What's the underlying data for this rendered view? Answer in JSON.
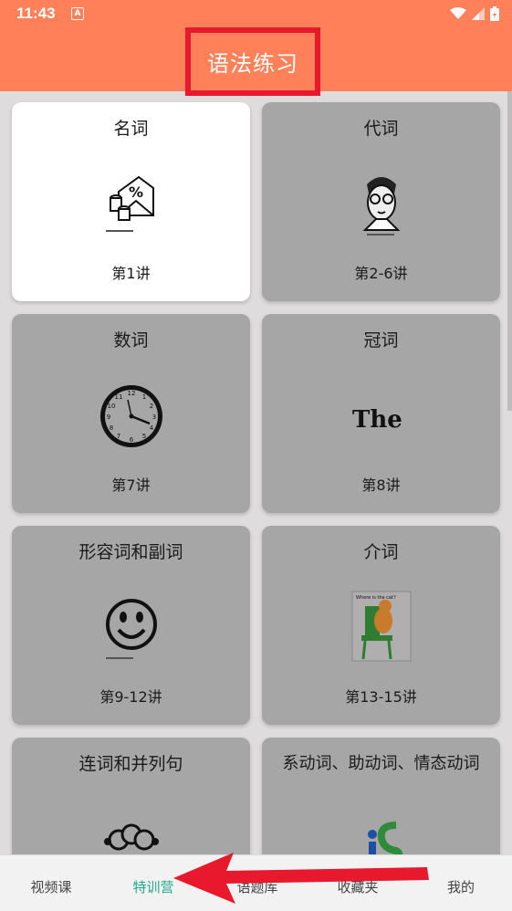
{
  "status_bar": {
    "time": "11:43",
    "notification_glyph": "A"
  },
  "app_bar": {
    "title": "语法练习"
  },
  "cards": [
    {
      "name": "名词",
      "lessons": "第1讲",
      "icon": "envelope-percent-coins-icon",
      "active": true
    },
    {
      "name": "代词",
      "lessons": "第2-6讲",
      "icon": "glasses-man-icon",
      "active": false
    },
    {
      "name": "数词",
      "lessons": "第7讲",
      "icon": "clock-icon",
      "active": false
    },
    {
      "name": "冠词",
      "lessons": "第8讲",
      "icon": "the-word-icon",
      "icon_text": "The",
      "active": false
    },
    {
      "name": "形容词和副词",
      "lessons": "第9-12讲",
      "icon": "smiley-face-icon",
      "active": false
    },
    {
      "name": "介词",
      "lessons": "第13-15讲",
      "icon": "cat-on-chair-icon",
      "icon_text": "Where is the cat?",
      "active": false
    },
    {
      "name": "连词和并列句",
      "lessons": "",
      "icon": "linked-people-icon",
      "active": false
    },
    {
      "name": "系动词、助动词、情态动词",
      "lessons": "",
      "icon": "is-letters-icon",
      "active": false
    }
  ],
  "bottom_nav": {
    "items": [
      {
        "label": "视频课",
        "active": false
      },
      {
        "label": "特训营",
        "active": true
      },
      {
        "label": "语题库",
        "active": false
      },
      {
        "label": "收藏夹",
        "active": false
      },
      {
        "label": "我的",
        "active": false
      }
    ]
  },
  "colors": {
    "header": "#ff8059",
    "highlight_box": "#e8192c",
    "active_tab": "#25a88e",
    "arrow": "#e8192c"
  }
}
